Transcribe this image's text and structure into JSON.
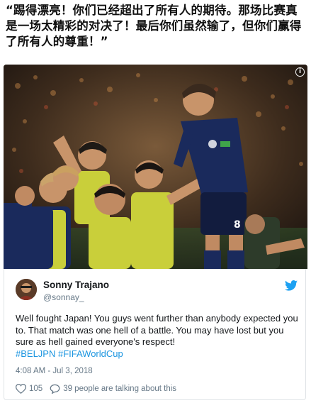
{
  "caption": "“踢得漂亮！你们已经超出了所有人的期待。那场比赛真是一场太精彩的对决了！最后你们虽然输了，但你们赢得了所有人的尊重！”",
  "photo": {
    "info_icon": "info-icon",
    "alt_scene": "players-celebrating"
  },
  "tweet": {
    "author_name": "Sonny Trajano",
    "author_handle": "@sonnay_",
    "text_plain": "Well fought Japan! You guys went further than anybody expected you to. That match was one hell of a battle. You may have lost but you sure as hell gained everyone's respect!",
    "hashtags": "#BELJPN #FIFAWorldCup",
    "timestamp": "4:08 AM - Jul 3, 2018",
    "like_count": "105",
    "talking_text": "39 people are talking about this",
    "brand_icon": "twitter-bird-icon"
  },
  "colors": {
    "twitter_blue": "#1da1f2",
    "hashtag_blue": "#1b95e0",
    "jersey_blue": "#1a2a5c",
    "bib_yellow": "#c9cf3a"
  }
}
